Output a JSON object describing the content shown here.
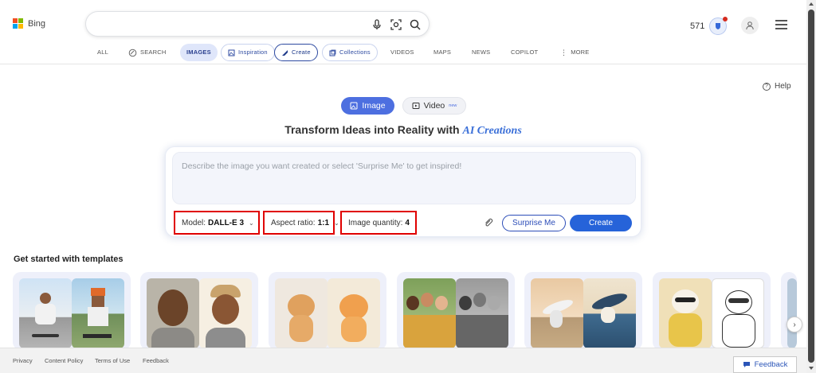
{
  "header": {
    "logo_text": "Bing",
    "search_value": "",
    "search_placeholder": "",
    "rewards_points": "571",
    "icons": [
      "microphone-icon",
      "visual-search-icon",
      "search-icon",
      "rewards-icon",
      "user-icon",
      "menu-icon"
    ]
  },
  "nav": {
    "items": [
      {
        "label": "ALL"
      },
      {
        "label": "SEARCH"
      },
      {
        "label": "IMAGES"
      },
      {
        "label": "Inspiration"
      },
      {
        "label": "Create"
      },
      {
        "label": "Collections"
      },
      {
        "label": "VIDEOS"
      },
      {
        "label": "MAPS"
      },
      {
        "label": "NEWS"
      },
      {
        "label": "COPILOT"
      },
      {
        "label": "MORE"
      }
    ],
    "active": "IMAGES"
  },
  "main": {
    "help_label": "Help",
    "mode_tabs": {
      "image_label": "Image",
      "video_label": "Video",
      "video_badge": "new"
    },
    "headline_prefix": "Transform Ideas into Reality with ",
    "headline_accent": "AI Creations",
    "prompt_placeholder": "Describe the image you want created or select 'Surprise Me' to get inspired!",
    "options": {
      "model_label": "Model:",
      "model_value": "DALL-E 3",
      "aspect_label": "Aspect ratio:",
      "aspect_value": "1:1",
      "quantity_label": "Image quantity:",
      "quantity_value": "4"
    },
    "surprise_label": "Surprise Me",
    "create_label": "Create",
    "templates_title": "Get started with templates"
  },
  "footer": {
    "links": [
      "Privacy",
      "Content Policy",
      "Terms of Use",
      "Feedback"
    ],
    "feedback_button": "Feedback"
  },
  "colors": {
    "accent_blue": "#2663d9",
    "highlight_red": "#e00000",
    "nav_active_bg": "#dfe6fa"
  }
}
